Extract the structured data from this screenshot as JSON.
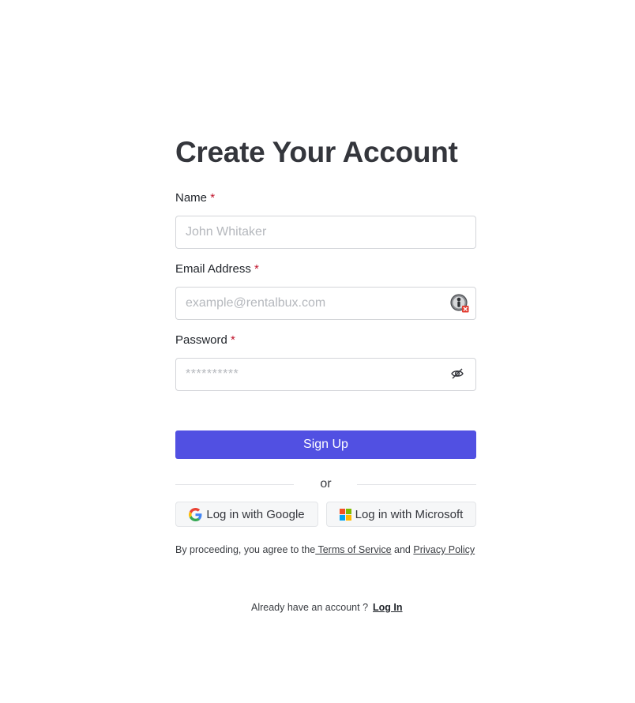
{
  "page": {
    "title": "Create Your Account"
  },
  "fields": {
    "name": {
      "label": "Name",
      "required_mark": "*",
      "placeholder": "John Whitaker",
      "value": ""
    },
    "email": {
      "label": "Email Address",
      "required_mark": "*",
      "placeholder": "example@rentalbux.com",
      "value": ""
    },
    "password": {
      "label": "Password",
      "required_mark": "*",
      "placeholder": "**********",
      "value": ""
    }
  },
  "actions": {
    "signup_label": "Sign Up",
    "divider_text": "or",
    "google_label": "Log in with Google",
    "microsoft_label": "Log in with Microsoft"
  },
  "terms": {
    "prefix": "By proceeding, you agree to the",
    "tos_label": " Terms of Service",
    "conjunction": " and ",
    "privacy_label": "Privacy Policy"
  },
  "footer": {
    "prompt": "Already have an account ?",
    "login_label": "Log In"
  },
  "colors": {
    "primary": "#5150e2",
    "required": "#c0132b",
    "border": "#d3d5d9"
  },
  "icons": {
    "email_field": "password-manager-icon",
    "password_field": "eye-off-icon",
    "google": "google-logo-icon",
    "microsoft": "microsoft-logo-icon"
  }
}
